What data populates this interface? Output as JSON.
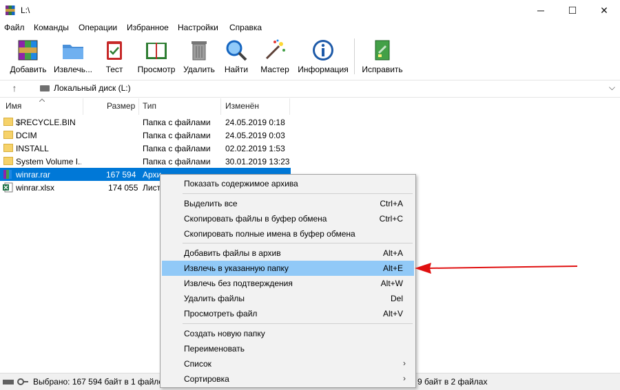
{
  "window": {
    "title": "L:\\"
  },
  "window_controls": {
    "minimize": "─",
    "maximize": "☐",
    "close": "✕"
  },
  "menubar": [
    "Файл",
    "Команды",
    "Операции",
    "Избранное",
    "Настройки",
    "Справка"
  ],
  "toolbar": [
    {
      "label": "Добавить",
      "icon": "archive-add-icon"
    },
    {
      "label": "Извлечь...",
      "icon": "folder-extract-icon"
    },
    {
      "label": "Тест",
      "icon": "clipboard-test-icon"
    },
    {
      "label": "Просмотр",
      "icon": "book-view-icon"
    },
    {
      "label": "Удалить",
      "icon": "trash-icon"
    },
    {
      "label": "Найти",
      "icon": "magnifier-icon"
    },
    {
      "label": "Мастер",
      "icon": "magic-wand-icon"
    },
    {
      "label": "Информация",
      "icon": "info-icon"
    },
    {
      "label": "Исправить",
      "icon": "repair-icon"
    }
  ],
  "address": {
    "up": "↑",
    "path": "Локальный диск (L:)",
    "dropdown": "⌵"
  },
  "columns": {
    "name": "Имя",
    "size": "Размер",
    "type": "Тип",
    "modified": "Изменён"
  },
  "files": [
    {
      "name": "$RECYCLE.BIN",
      "size": "",
      "type": "Папка с файлами",
      "modified": "24.05.2019 0:18",
      "kind": "folder"
    },
    {
      "name": "DCIM",
      "size": "",
      "type": "Папка с файлами",
      "modified": "24.05.2019 0:03",
      "kind": "folder"
    },
    {
      "name": "INSTALL",
      "size": "",
      "type": "Папка с файлами",
      "modified": "02.02.2019 1:53",
      "kind": "folder"
    },
    {
      "name": "System Volume I...",
      "size": "",
      "type": "Папка с файлами",
      "modified": "30.01.2019 13:23",
      "kind": "folder"
    },
    {
      "name": "winrar.rar",
      "size": "167 594",
      "type": "Архи",
      "modified": "",
      "kind": "rar",
      "selected": true
    },
    {
      "name": "winrar.xlsx",
      "size": "174 055",
      "type": "Лист",
      "modified": "",
      "kind": "xlsx"
    }
  ],
  "status": {
    "left": "Выбрано: 167 594 байт в 1 файле",
    "right": "9 байт в 2 файлах"
  },
  "context_menu": [
    {
      "label": "Показать содержимое архива",
      "key": ""
    },
    {
      "sep": true
    },
    {
      "label": "Выделить все",
      "key": "Ctrl+A"
    },
    {
      "label": "Скопировать файлы в буфер обмена",
      "key": "Ctrl+C"
    },
    {
      "label": "Скопировать полные имена в буфер обмена",
      "key": ""
    },
    {
      "sep": true
    },
    {
      "label": "Добавить файлы в архив",
      "key": "Alt+A"
    },
    {
      "label": "Извлечь в указанную папку",
      "key": "Alt+E",
      "highlighted": true
    },
    {
      "label": "Извлечь без подтверждения",
      "key": "Alt+W"
    },
    {
      "label": "Удалить файлы",
      "key": "Del"
    },
    {
      "label": "Просмотреть файл",
      "key": "Alt+V"
    },
    {
      "sep": true
    },
    {
      "label": "Создать новую папку",
      "key": ""
    },
    {
      "label": "Переименовать",
      "key": ""
    },
    {
      "label": "Список",
      "key": "",
      "submenu": true
    },
    {
      "label": "Сортировка",
      "key": "",
      "submenu": true
    }
  ],
  "colors": {
    "selection": "#0078d7",
    "menu_highlight": "#91c9f7",
    "annotation_arrow": "#e01010"
  }
}
